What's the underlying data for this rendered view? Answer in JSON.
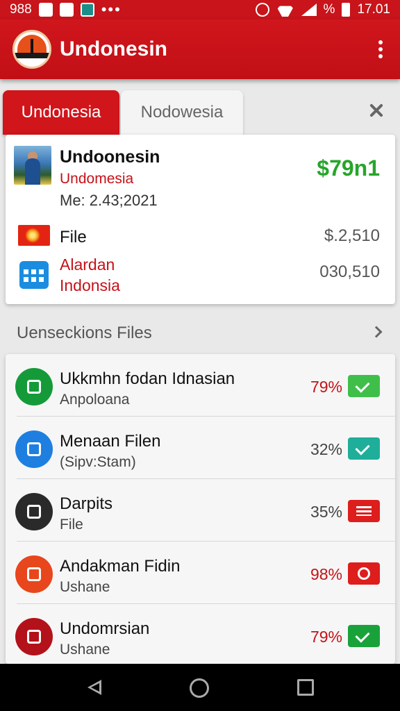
{
  "status_bar": {
    "left_text": "988",
    "battery_pct": "%",
    "time": "17.01",
    "icons": [
      "nfc-icon",
      "mail-icon",
      "photo-icon",
      "more-dots-icon",
      "alarm-icon",
      "wifi-icon",
      "signal-icon",
      "battery-icon"
    ]
  },
  "app_bar": {
    "title": "Undonesin",
    "logo_icon": "flag-logo-icon",
    "menu_icon": "more-vert-icon"
  },
  "tabs": [
    {
      "label": "Undonesia",
      "active": true
    },
    {
      "label": "Nodowesia",
      "active": false
    }
  ],
  "summary_card": {
    "name": "Undoonesin",
    "subtitle": "Undomesia",
    "meta": "Me: 2.43;2021",
    "amount": "$79n1",
    "rows": [
      {
        "icon": "flag-icon",
        "label": "File",
        "value": "$.2,510"
      },
      {
        "icon": "calendar-icon",
        "label_line1": "Alardan",
        "label_line2": "Indonsia",
        "value": "030,510"
      }
    ]
  },
  "section": {
    "title": "Uenseckions Files"
  },
  "files": [
    {
      "title": "Ukkmhn fodan Idnasian",
      "subtitle": "Anpoloana",
      "percent": "79%",
      "percent_color": "#c61117",
      "icon": "phone-icon",
      "icon_color": "#159a3a",
      "badge": "check",
      "badge_color": "#3fbf4a"
    },
    {
      "title": "Menaan Filen",
      "subtitle": "(Sipv:Stam)",
      "percent": "32%",
      "percent_color": "#444444",
      "icon": "mail-icon",
      "icon_color": "#1e7fe0",
      "badge": "check",
      "badge_color": "#1fae9a"
    },
    {
      "title": "Darpits",
      "subtitle": "File",
      "percent": "35%",
      "percent_color": "#444444",
      "icon": "clock-icon",
      "icon_color": "#2a2a2a",
      "badge": "lines",
      "badge_color": "#de1d1d"
    },
    {
      "title": "Andakman Fidin",
      "subtitle": "Ushane",
      "percent": "98%",
      "percent_color": "#c61117",
      "icon": "book-icon",
      "icon_color": "#e8461c",
      "badge": "timer",
      "badge_color": "#de1d1d"
    },
    {
      "title": "Undomrsian",
      "subtitle": "Ushane",
      "percent": "79%",
      "percent_color": "#c61117",
      "icon": "list-icon",
      "icon_color": "#b3121a",
      "badge": "check",
      "badge_color": "#19a23a"
    }
  ],
  "nav_bar": {
    "icons": [
      "back-icon",
      "home-icon",
      "recents-icon"
    ]
  }
}
